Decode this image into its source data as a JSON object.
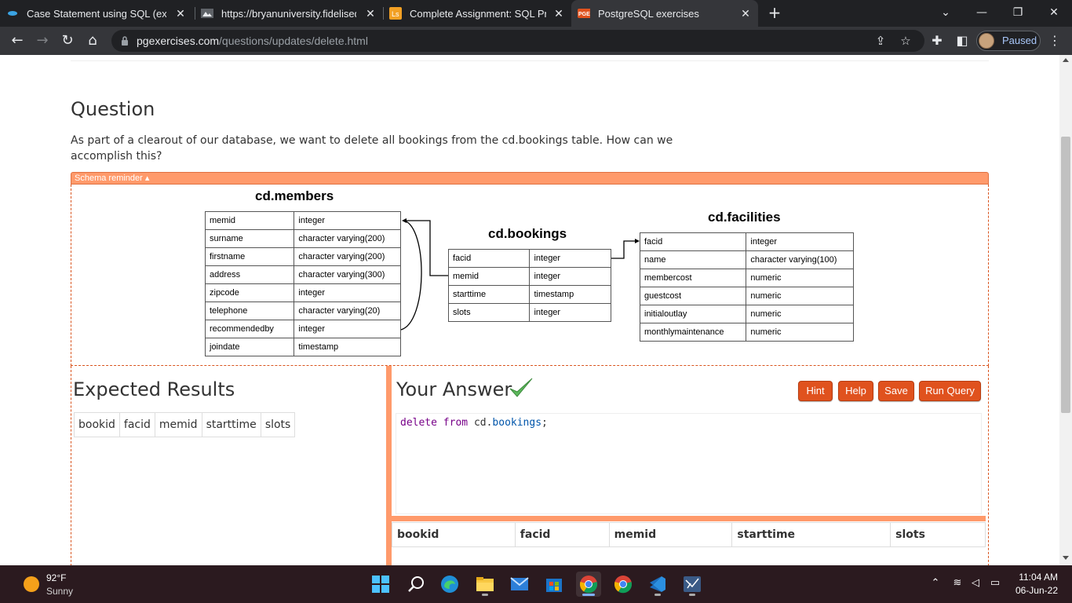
{
  "browser": {
    "tabs": [
      {
        "title": "Case Statement using SQL (exam",
        "icon": "sql-site-icon"
      },
      {
        "title": "https://bryanuniversity.fidelisedu",
        "icon": "fidelis-icon"
      },
      {
        "title": "Complete Assignment: SQL Pract",
        "icon": "learn-icon"
      },
      {
        "title": "PostgreSQL exercises",
        "icon": "pge-icon",
        "active": true
      }
    ],
    "url_host": "pgexercises.com",
    "url_path": "/questions/updates/delete.html",
    "profile_status": "Paused"
  },
  "page": {
    "question_heading": "Question",
    "question_text": "As part of a clearout of our database, we want to delete all bookings from the cd.bookings table. How can we accomplish this?",
    "schema_toggle": "Schema reminder ▴",
    "schema": {
      "members": {
        "title": "cd.members",
        "rows": [
          [
            "memid",
            "integer"
          ],
          [
            "surname",
            "character varying(200)"
          ],
          [
            "firstname",
            "character varying(200)"
          ],
          [
            "address",
            "character varying(300)"
          ],
          [
            "zipcode",
            "integer"
          ],
          [
            "telephone",
            "character varying(20)"
          ],
          [
            "recommendedby",
            "integer"
          ],
          [
            "joindate",
            "timestamp"
          ]
        ]
      },
      "bookings": {
        "title": "cd.bookings",
        "rows": [
          [
            "facid",
            "integer"
          ],
          [
            "memid",
            "integer"
          ],
          [
            "starttime",
            "timestamp"
          ],
          [
            "slots",
            "integer"
          ]
        ]
      },
      "facilities": {
        "title": "cd.facilities",
        "rows": [
          [
            "facid",
            "integer"
          ],
          [
            "name",
            "character varying(100)"
          ],
          [
            "membercost",
            "numeric"
          ],
          [
            "guestcost",
            "numeric"
          ],
          [
            "initialoutlay",
            "numeric"
          ],
          [
            "monthlymaintenance",
            "numeric"
          ]
        ]
      }
    },
    "expected_heading": "Expected Results",
    "expected_columns": [
      "bookid",
      "facid",
      "memid",
      "starttime",
      "slots"
    ],
    "answer_heading": "Your Answer",
    "buttons": {
      "hint": "Hint",
      "help": "Help",
      "save": "Save",
      "run": "Run Query"
    },
    "query": {
      "kw1": "delete",
      "kw2": "from",
      "schema": "cd",
      "table": "bookings"
    },
    "result_columns": [
      "bookid",
      "facid",
      "memid",
      "starttime",
      "slots"
    ]
  },
  "taskbar": {
    "temperature": "92°F",
    "condition": "Sunny",
    "time": "11:04 AM",
    "date": "06-Jun-22"
  },
  "colors": {
    "accent_orange": "#e0521e",
    "splitter": "#ff9a6b",
    "chrome_dark": "#202124"
  }
}
